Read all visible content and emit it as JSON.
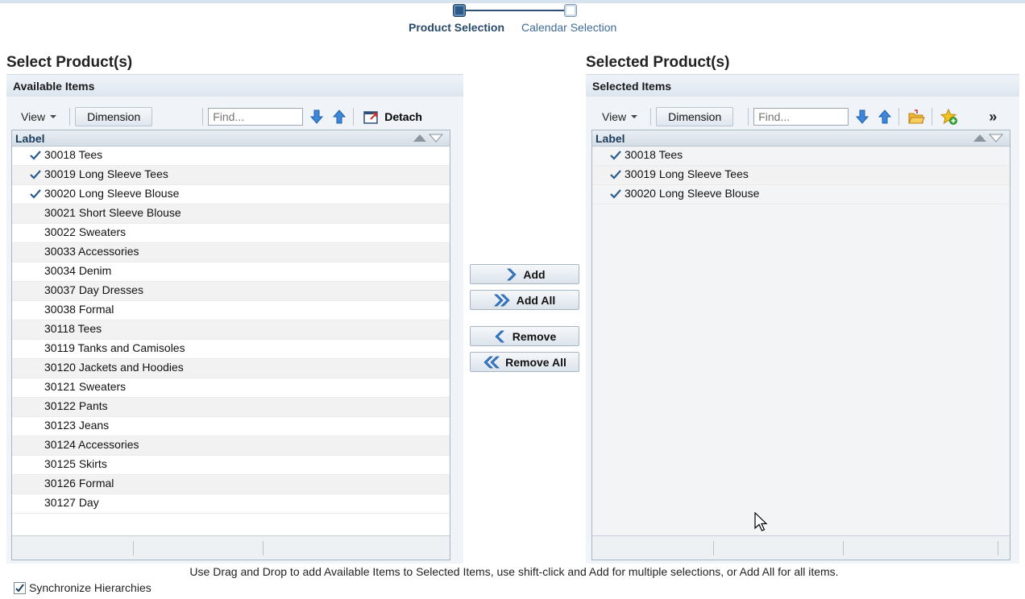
{
  "train": {
    "step1": "Product Selection",
    "step2": "Calendar Selection"
  },
  "left": {
    "title": "Select Product(s)",
    "header": "Available Items",
    "toolbar": {
      "view": "View",
      "dimension": "Dimension",
      "find_placeholder": "Find...",
      "detach": "Detach"
    },
    "column_label": "Label",
    "items": [
      {
        "label": "30018 Tees",
        "checked": true
      },
      {
        "label": "30019 Long Sleeve Tees",
        "checked": true
      },
      {
        "label": "30020 Long Sleeve Blouse",
        "checked": true
      },
      {
        "label": "30021 Short Sleeve Blouse",
        "checked": false
      },
      {
        "label": "30022 Sweaters",
        "checked": false
      },
      {
        "label": "30033 Accessories",
        "checked": false
      },
      {
        "label": "30034 Denim",
        "checked": false
      },
      {
        "label": "30037 Day Dresses",
        "checked": false
      },
      {
        "label": "30038 Formal",
        "checked": false
      },
      {
        "label": "30118 Tees",
        "checked": false
      },
      {
        "label": "30119 Tanks and Camisoles",
        "checked": false
      },
      {
        "label": "30120 Jackets and Hoodies",
        "checked": false
      },
      {
        "label": "30121 Sweaters",
        "checked": false
      },
      {
        "label": "30122 Pants",
        "checked": false
      },
      {
        "label": "30123 Jeans",
        "checked": false
      },
      {
        "label": "30124 Accessories",
        "checked": false
      },
      {
        "label": "30125 Skirts",
        "checked": false
      },
      {
        "label": "30126 Formal",
        "checked": false
      },
      {
        "label": "30127 Day",
        "checked": false
      }
    ]
  },
  "right": {
    "title": "Selected Product(s)",
    "header": "Selected Items",
    "toolbar": {
      "view": "View",
      "dimension": "Dimension",
      "find_placeholder": "Find...",
      "more": "»"
    },
    "column_label": "Label",
    "items": [
      {
        "label": "30018 Tees",
        "checked": true
      },
      {
        "label": "30019 Long Sleeve Tees",
        "checked": true
      },
      {
        "label": "30020 Long Sleeve Blouse",
        "checked": true
      }
    ]
  },
  "shuttle": {
    "add": "Add",
    "add_all": "Add All",
    "remove": "Remove",
    "remove_all": "Remove All"
  },
  "hint": "Use Drag and Drop to add Available Items to Selected Items, use shift-click and Add for multiple selections, or Add All for all items.",
  "sync_label": "Synchronize Hierarchies",
  "sync_checked": true,
  "colors": {
    "accent": "#2e5a85",
    "header_bg": "#dde6ef",
    "check": "#2c5b8c"
  }
}
